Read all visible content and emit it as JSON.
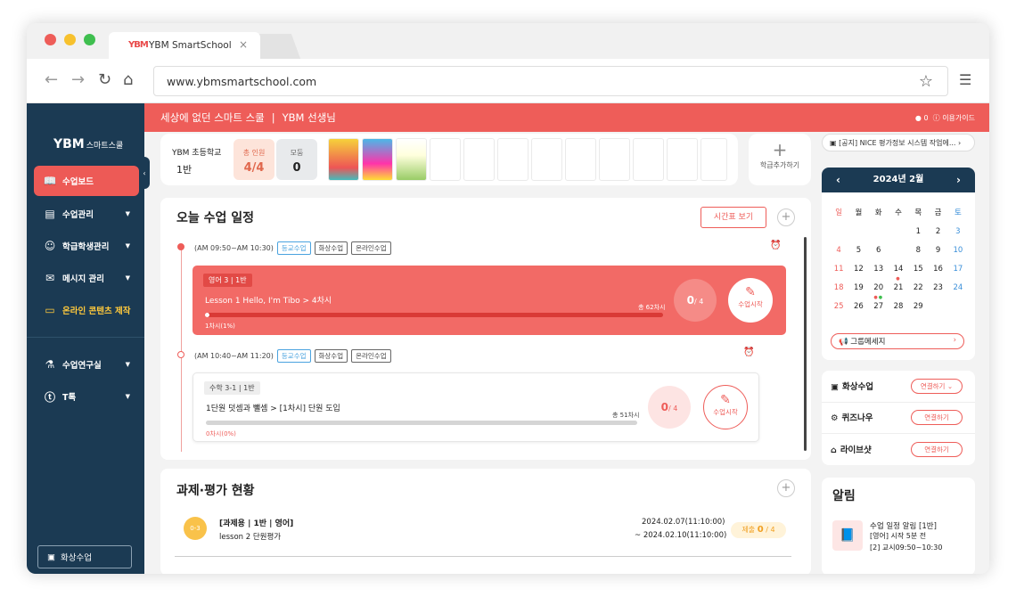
{
  "browser": {
    "tab_logo": "YBM",
    "tab_title": "YBM SmartSchool",
    "tab_close": "×",
    "url": "www.ybmsmartschool.com"
  },
  "sidebar": {
    "logo": "YBM",
    "logo_sub": "스마트스쿨",
    "items": [
      {
        "label": "수업보드",
        "icon": "book-icon"
      },
      {
        "label": "수업관리",
        "icon": "board-icon"
      },
      {
        "label": "학급학생관리",
        "icon": "people-icon"
      },
      {
        "label": "메시지 관리",
        "icon": "message-icon"
      },
      {
        "label": "온라인 콘텐츠 제작",
        "icon": "monitor-icon"
      },
      {
        "label": "수업연구실",
        "icon": "microscope-icon"
      },
      {
        "label": "T톡",
        "icon": "talk-icon"
      }
    ],
    "video_button": "화상수업"
  },
  "topbar": {
    "slogan": "세상에 없던 스마트 스쿨",
    "user": "YBM 선생님",
    "guide": "이용가이드",
    "notif_count": "0"
  },
  "class": {
    "school": "YBM 초등학교",
    "ban": "1반",
    "total_label": "총 인원",
    "total_value": "4/4",
    "group_label": "모둠",
    "group_value": "0",
    "add_label": "학급추가하기"
  },
  "notice": "[공지] NICE 평가정보 시스템 작업에...",
  "today": {
    "title": "오늘 수업 일정",
    "timetable_button": "시간표 보기",
    "lessons": [
      {
        "time": "(AM 09:50~AM 10:30)",
        "tags": [
          "등교수업",
          "화상수업",
          "온라인수업"
        ],
        "subject": "영어 3 | 1반",
        "lesson": "Lesson 1 Hello, I'm Tibo  >  4차시",
        "total": "총 62차시",
        "progress_text": "1차시(1%)",
        "progress": 0.01,
        "count": "0",
        "count_total": "/ 4",
        "start": "수업시작"
      },
      {
        "time": "(AM 10:40~AM 11:20)",
        "tags": [
          "등교수업",
          "화상수업",
          "온라인수업"
        ],
        "subject": "수학 3-1 | 1반",
        "lesson": "1단원 덧셈과 뺄셈  >  [1차시] 단원 도입",
        "total": "총 51차시",
        "progress_text": "0차시(0%)",
        "progress": 0,
        "count": "0",
        "count_total": "/ 4",
        "start": "수업시작"
      }
    ]
  },
  "homework": {
    "title": "과제·평가 현황",
    "badge": "0-3",
    "item_title": "[과제용 | 1반 | 영어]",
    "item_sub": "lesson 2 단원평가",
    "date_from": "2024.02.07(11:10:00)",
    "date_to": "~ 2024.02.10(11:10:00)",
    "submit_label": "제출",
    "submit_count": "0",
    "submit_total": "/ 4"
  },
  "calendar": {
    "month": "2024년 2월",
    "weekdays": [
      "일",
      "월",
      "화",
      "수",
      "목",
      "금",
      "토"
    ],
    "weeks": [
      [
        "",
        "",
        "",
        "",
        "1",
        "2",
        "3"
      ],
      [
        "4",
        "5",
        "6",
        "7",
        "8",
        "9",
        "10"
      ],
      [
        "11",
        "12",
        "13",
        "14",
        "15",
        "16",
        "17"
      ],
      [
        "18",
        "19",
        "20",
        "21",
        "22",
        "23",
        "24"
      ],
      [
        "25",
        "26",
        "27",
        "28",
        "29",
        "",
        ""
      ]
    ],
    "today": "7",
    "group_message": "그룹메세지"
  },
  "tools": [
    {
      "label": "화상수업",
      "icon": "video-board-icon",
      "link": "연결하기"
    },
    {
      "label": "퀴즈나우",
      "icon": "quiz-icon",
      "link": "연결하기"
    },
    {
      "label": "라이브샷",
      "icon": "live-icon",
      "link": "연결하기"
    }
  ],
  "alarm": {
    "title": "알림",
    "line1": "수업 일정 알림 [1반]",
    "line2": "[영어] 시작 5분 전",
    "line3": "[2] 교시09:50~10:30"
  },
  "colors": {
    "accent": "#ee5d59",
    "navy": "#1b3a53",
    "blue_tag": "#4aa3df"
  }
}
